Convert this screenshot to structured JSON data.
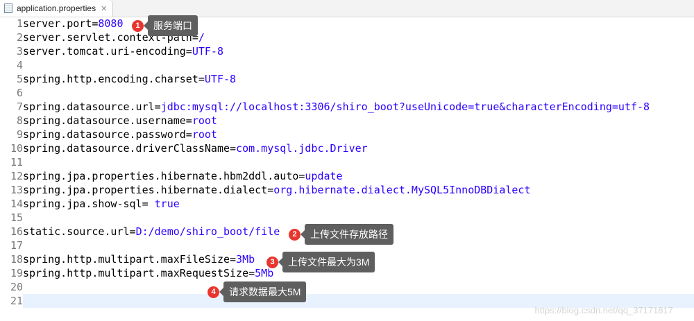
{
  "tab": {
    "title": "application.properties",
    "close": "✕"
  },
  "lines": [
    {
      "n": "1",
      "k": "server.port=",
      "v": "8080"
    },
    {
      "n": "2",
      "k": "server.servlet.context-path=",
      "v": "/"
    },
    {
      "n": "3",
      "k": "server.tomcat.uri-encoding=",
      "v": "UTF-8"
    },
    {
      "n": "4",
      "k": "",
      "v": ""
    },
    {
      "n": "5",
      "k": "spring.http.encoding.charset=",
      "v": "UTF-8"
    },
    {
      "n": "6",
      "k": "",
      "v": ""
    },
    {
      "n": "7",
      "k": "spring.datasource.url=",
      "v": "jdbc:mysql://localhost:3306/shiro_boot?useUnicode=true&characterEncoding=utf-8"
    },
    {
      "n": "8",
      "k": "spring.datasource.username=",
      "v": "root"
    },
    {
      "n": "9",
      "k": "spring.datasource.password=",
      "v": "root"
    },
    {
      "n": "10",
      "k": "spring.datasource.driverClassName=",
      "v": "com.mysql.jdbc.Driver"
    },
    {
      "n": "11",
      "k": "",
      "v": ""
    },
    {
      "n": "12",
      "k": "spring.jpa.properties.hibernate.hbm2ddl.auto=",
      "v": "update"
    },
    {
      "n": "13",
      "k": "spring.jpa.properties.hibernate.dialect=",
      "v": "org.hibernate.dialect.MySQL5InnoDBDialect"
    },
    {
      "n": "14",
      "k": "spring.jpa.show-sql=",
      "v": " true"
    },
    {
      "n": "15",
      "k": "",
      "v": ""
    },
    {
      "n": "16",
      "k": "static.source.url=",
      "v": "D:/demo/shiro_boot/file"
    },
    {
      "n": "17",
      "k": "",
      "v": ""
    },
    {
      "n": "18",
      "k": "spring.http.multipart.maxFileSize=",
      "v": "3Mb"
    },
    {
      "n": "19",
      "k": "spring.http.multipart.maxRequestSize=",
      "v": "5Mb"
    },
    {
      "n": "20",
      "k": "",
      "v": ""
    },
    {
      "n": "21",
      "k": "",
      "v": ""
    }
  ],
  "annotations": [
    {
      "num": "1",
      "text": "服务端口"
    },
    {
      "num": "2",
      "text": "上传文件存放路径"
    },
    {
      "num": "3",
      "text": "上传文件最大为3M"
    },
    {
      "num": "4",
      "text": "请求数据最大5M"
    }
  ],
  "watermark": "https://blog.csdn.net/qq_37171817"
}
